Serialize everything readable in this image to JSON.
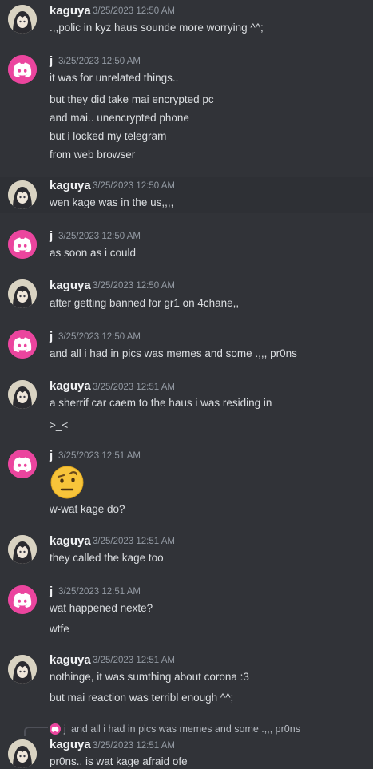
{
  "users": {
    "kaguya": "kaguya",
    "j": "j"
  },
  "messages": [
    {
      "ts": "3/25/2023 12:50 AM",
      "lines": [
        ".,,polic in kyz haus sounde more worrying ^^;"
      ]
    },
    {
      "ts": "3/25/2023 12:50 AM",
      "lines": [
        "it was for unrelated things..",
        "but they did take mai encrypted pc",
        "and mai.. unencrypted phone",
        "but i locked my telegram",
        "from web browser"
      ]
    },
    {
      "ts": "3/25/2023 12:50 AM",
      "lines": [
        "wen kage was in the us,,,,"
      ]
    },
    {
      "ts": "3/25/2023 12:50 AM",
      "lines": [
        "as soon as i could"
      ]
    },
    {
      "ts": "3/25/2023 12:50 AM",
      "lines": [
        "after getting banned for gr1 on 4chane,,"
      ]
    },
    {
      "ts": "3/25/2023 12:50 AM",
      "lines": [
        "and all i had in pics was memes and some .,,, pr0ns"
      ]
    },
    {
      "ts": "3/25/2023 12:51 AM",
      "lines": [
        "a sherrif car caem to the haus i was residing in",
        ">_<"
      ]
    },
    {
      "ts": "3/25/2023 12:51 AM",
      "emoji": "face-with-raised-eyebrow",
      "lines": [
        "w-wat kage do?"
      ]
    },
    {
      "ts": "3/25/2023 12:51 AM",
      "lines": [
        "they called the kage too"
      ]
    },
    {
      "ts": "3/25/2023 12:51 AM",
      "lines": [
        "wat happened nexte?",
        "wtfe"
      ]
    },
    {
      "ts": "3/25/2023 12:51 AM",
      "lines": [
        "nothinge, it was sumthing about corona :3",
        "but mai reaction was terribl enough ^^;"
      ]
    },
    {
      "ts": "3/25/2023 12:51 AM",
      "reply": {
        "name": "j",
        "text": "and all i had in pics was memes and some .,,, pr0ns"
      },
      "lines": [
        "pr0ns.. is wat kage afraid ofe"
      ]
    }
  ],
  "colors": {
    "background": "#313338",
    "hover": "#2e3035",
    "j_avatar": "#eb459e",
    "name": "#f2f3f5",
    "timestamp": "#949ba4",
    "text": "#dbdee1"
  },
  "icons": {
    "j_avatar": "discord-logo-icon",
    "kaguya_avatar": "anime-avatar-icon"
  }
}
